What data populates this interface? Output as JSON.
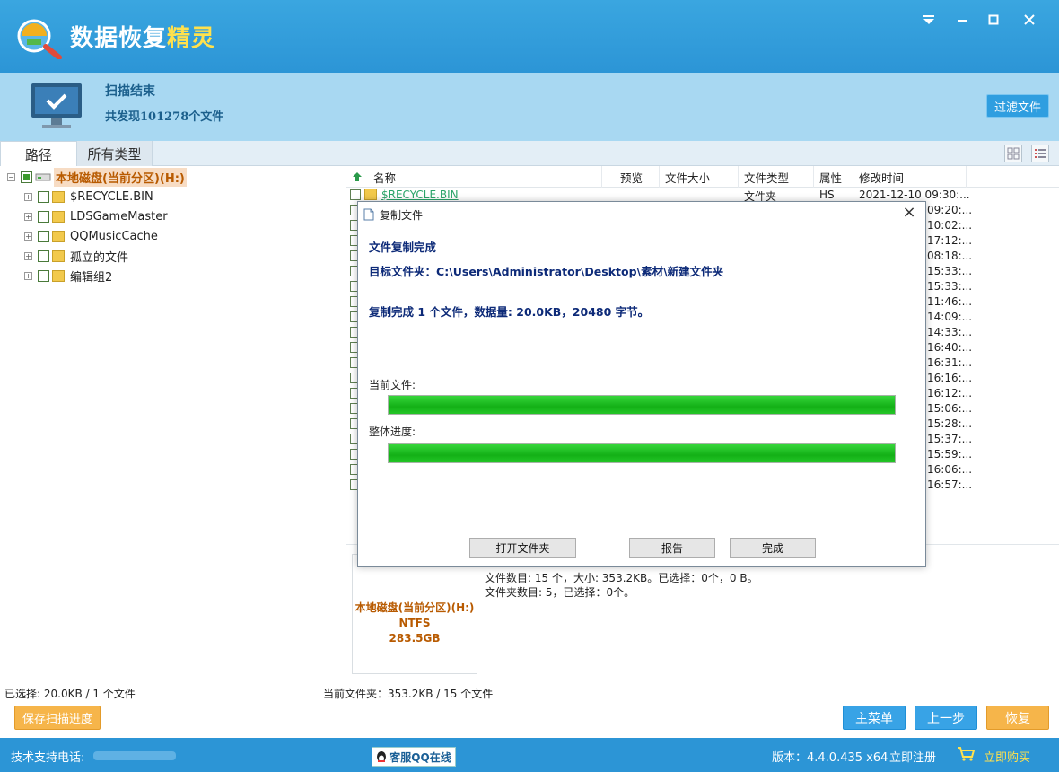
{
  "app": {
    "title_main": "数据恢复",
    "title_highlight": "精灵"
  },
  "window_controls": [
    "menu",
    "minimize",
    "maximize",
    "close"
  ],
  "status": {
    "title": "扫描结束",
    "found": "共发现101278个文件",
    "filter_button": "过滤文件"
  },
  "tabs": [
    {
      "label": "路径",
      "active": true
    },
    {
      "label": "所有类型",
      "active": false
    }
  ],
  "tree": {
    "root": "本地磁盘(当前分区)(H:)",
    "items": [
      "$RECYCLE.BIN",
      "LDSGameMaster",
      "QQMusicCache",
      "孤立的文件",
      "编辑组2"
    ]
  },
  "list": {
    "columns": [
      "名称",
      "预览",
      "文件大小",
      "文件类型",
      "属性",
      "修改时间"
    ],
    "first_row": {
      "name": "$RECYCLE.BIN",
      "type": "文件夹",
      "attr": "HS",
      "time": "2021-12-10 09:30:..."
    },
    "time_fragments": [
      "09:20:...",
      "10:02:...",
      "17:12:...",
      "08:18:...",
      "15:33:...",
      "15:33:...",
      "11:46:...",
      "14:09:...",
      "14:33:...",
      "16:40:...",
      "16:31:...",
      "16:16:...",
      "16:12:...",
      "15:06:...",
      "15:28:...",
      "15:37:...",
      "15:59:...",
      "16:06:...",
      "16:57:..."
    ]
  },
  "info": {
    "disk_name": "本地磁盘(当前分区)(H:)",
    "fs": "NTFS",
    "size": "283.5GB",
    "files_line": "文件数目: 15 个，大小: 353.2KB。已选择：0个，0 B。",
    "folders_line": "文件夹数目: 5，已选择：0个。"
  },
  "statusbar": {
    "selected": "已选择: 20.0KB / 1 个文件",
    "current_folder": "当前文件夹：353.2KB / 15 个文件"
  },
  "buttons": {
    "save_scan": "保存扫描进度",
    "main_menu": "主菜单",
    "prev_step": "上一步",
    "recover": "恢复"
  },
  "footer": {
    "support": "技术支持电话:",
    "qq": "客服QQ在线",
    "version": "版本：4.4.0.435 x64",
    "register": "立即注册",
    "buy": "立即购买"
  },
  "dialog": {
    "title": "复制文件",
    "done": "文件复制完成",
    "target_label": "目标文件夹：",
    "target_path": "C:\\Users\\Administrator\\Desktop\\素材\\新建文件夹",
    "summary": "复制完成 1 个文件，数据量: 20.0KB，20480 字节。",
    "current_file_label": "当前文件:",
    "overall_label": "整体进度:",
    "current_progress": 1.0,
    "overall_progress": 1.0,
    "open_folder": "打开文件夹",
    "report": "报告",
    "finish": "完成"
  },
  "colors": {
    "titlebar": "#2c95d6",
    "statusband": "#a8d8f2",
    "accent_orange": "#f6b54a",
    "progress_green": "#13b016"
  }
}
